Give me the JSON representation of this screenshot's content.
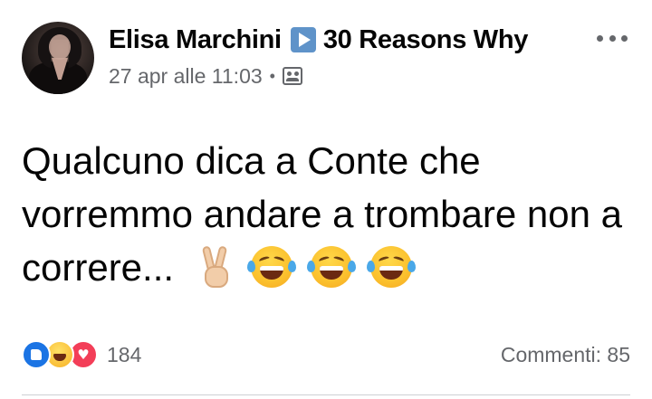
{
  "post": {
    "author": "Elisa Marchini",
    "shared_target": "30 Reasons Why",
    "timestamp": "27 apr alle 11:03",
    "separator": "•",
    "privacy_icon": "friends-icon",
    "more_icon": "more-horizontal-icon",
    "text": "Qualcuno dica a Conte che vorremmo andare a trombare non a correre...",
    "emojis": [
      "victory-hand-icon",
      "rolling-laughing-icon",
      "rolling-laughing-icon",
      "rolling-laughing-icon"
    ]
  },
  "footer": {
    "reactions": [
      "like-icon",
      "haha-icon",
      "love-icon"
    ],
    "reaction_count": "184",
    "comments": "Commenti: 85"
  },
  "colors": {
    "like": "#1b74e4",
    "love": "#f33e58",
    "secondary_text": "#65676b",
    "page_badge": "#5f93c9"
  }
}
